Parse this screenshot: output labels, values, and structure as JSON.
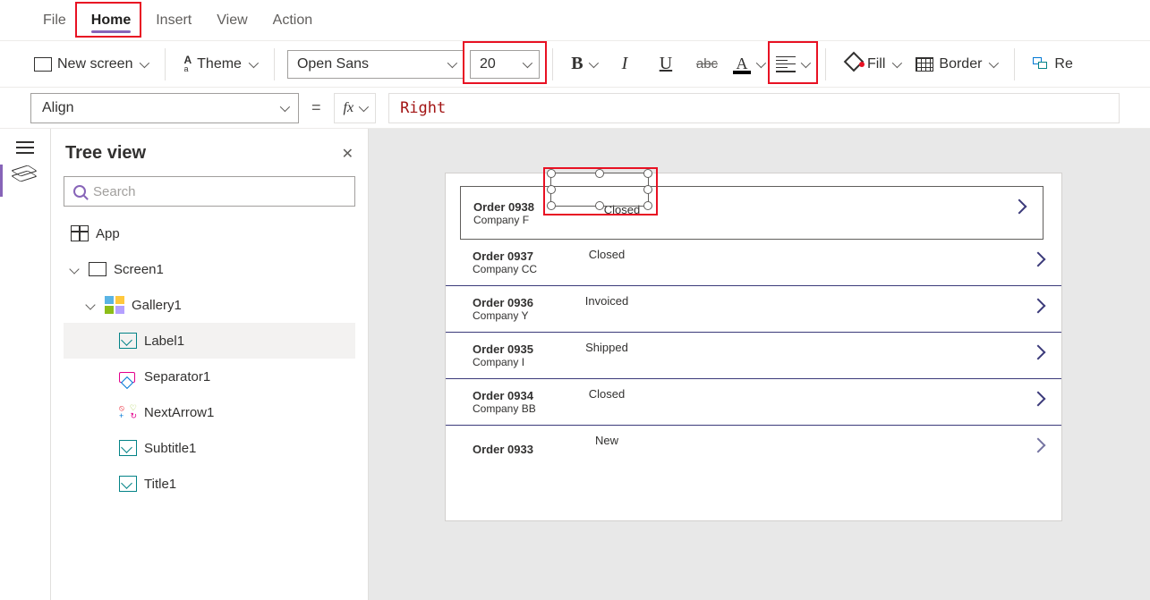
{
  "menu": {
    "file": "File",
    "home": "Home",
    "insert": "Insert",
    "view": "View",
    "action": "Action"
  },
  "ribbon": {
    "new_screen": "New screen",
    "theme": "Theme",
    "font_family": "Open Sans",
    "font_size": "20",
    "bold": "B",
    "italic": "I",
    "underline": "U",
    "strike": "abc",
    "fontcolor": "A",
    "fill": "Fill",
    "border": "Border",
    "reorder": "Re"
  },
  "formula": {
    "property": "Align",
    "fx": "fx",
    "value": "Right"
  },
  "tree": {
    "title": "Tree view",
    "search_placeholder": "Search",
    "app": "App",
    "screen1": "Screen1",
    "gallery1": "Gallery1",
    "label1": "Label1",
    "separator1": "Separator1",
    "nextarrow1": "NextArrow1",
    "subtitle1": "Subtitle1",
    "title1": "Title1"
  },
  "gallery_rows": [
    {
      "title": "Order 0938",
      "sub": "Company F",
      "status": "Closed"
    },
    {
      "title": "Order 0937",
      "sub": "Company CC",
      "status": "Closed"
    },
    {
      "title": "Order 0936",
      "sub": "Company Y",
      "status": "Invoiced"
    },
    {
      "title": "Order 0935",
      "sub": "Company I",
      "status": "Shipped"
    },
    {
      "title": "Order 0934",
      "sub": "Company BB",
      "status": "Closed"
    },
    {
      "title": "Order 0933",
      "sub": "",
      "status": "New"
    }
  ]
}
